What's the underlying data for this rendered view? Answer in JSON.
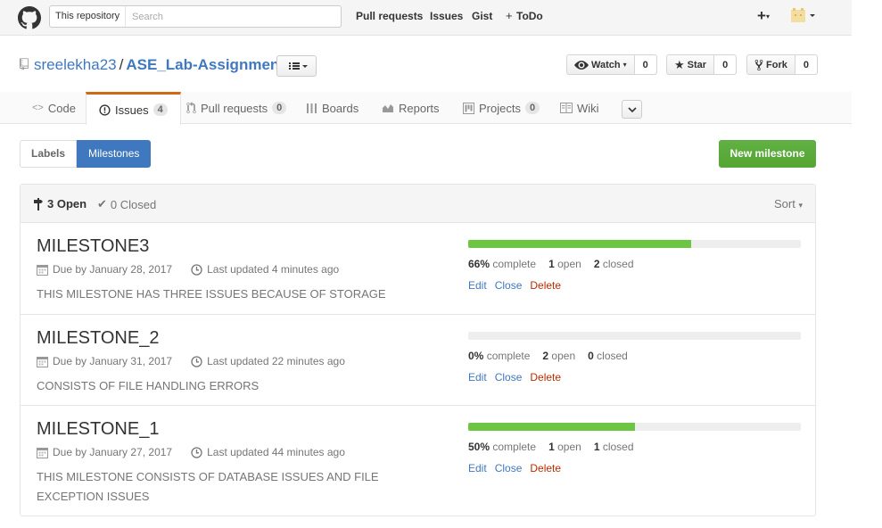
{
  "header": {
    "search_scope": "This repository",
    "search_placeholder": "Search",
    "nav": [
      "Pull requests",
      "Issues",
      "Gist",
      "ToDo"
    ],
    "plus_icon": "plus-icon",
    "avatar_icon": "avatar"
  },
  "repo": {
    "owner": "sreelekha23",
    "separator": "/",
    "name": "ASE_Lab-Assignments",
    "watch": {
      "label": "Watch",
      "count": "0"
    },
    "star": {
      "label": "Star",
      "count": "0"
    },
    "fork": {
      "label": "Fork",
      "count": "0"
    }
  },
  "tabs": [
    {
      "label": "Code",
      "icon": "code-icon"
    },
    {
      "label": "Issues",
      "icon": "issue-opened-icon",
      "counter": "4",
      "selected": true
    },
    {
      "label": "Pull requests",
      "icon": "git-pull-request-icon",
      "counter": "0"
    },
    {
      "label": "Boards",
      "icon": "boards-icon"
    },
    {
      "label": "Reports",
      "icon": "graph-icon"
    },
    {
      "label": "Projects",
      "icon": "project-icon",
      "counter": "0"
    },
    {
      "label": "Wiki",
      "icon": "book-icon"
    }
  ],
  "subnav": {
    "labels": "Labels",
    "milestones": "Milestones"
  },
  "new_milestone": "New milestone",
  "filter": {
    "open": "3 Open",
    "closed": "0 Closed",
    "sort": "Sort"
  },
  "milestones": [
    {
      "title": "MILESTONE3",
      "due": "Due by January 28, 2017",
      "updated": "Last updated 4 minutes ago",
      "description": "THIS MILESTONE HAS THREE ISSUES BECAUSE OF STORAGE",
      "percent": "66%",
      "progress_fraction": 0.67,
      "complete_label": "complete",
      "open_count": "1",
      "open_label": "open",
      "closed_count": "2",
      "closed_label": "closed"
    },
    {
      "title": "MILESTONE_2",
      "due": "Due by January 31, 2017",
      "updated": "Last updated 22 minutes ago",
      "description": "CONSISTS OF FILE HANDLING ERRORS",
      "percent": "0%",
      "progress_fraction": 0.0,
      "complete_label": "complete",
      "open_count": "2",
      "open_label": "open",
      "closed_count": "0",
      "closed_label": "closed"
    },
    {
      "title": "MILESTONE_1",
      "due": "Due by January 27, 2017",
      "updated": "Last updated 44 minutes ago",
      "description": "THIS MILESTONE CONSISTS OF DATABASE ISSUES AND FILE EXCEPTION ISSUES",
      "percent": "50%",
      "progress_fraction": 0.5,
      "complete_label": "complete",
      "open_count": "1",
      "open_label": "open",
      "closed_count": "1",
      "closed_label": "closed"
    }
  ],
  "actions": {
    "edit": "Edit",
    "close": "Close",
    "delete": "Delete"
  },
  "colors": {
    "accent": "#4078c0",
    "success": "#6cc644",
    "danger": "#bd2c00",
    "selected_tab": "#d26911"
  }
}
